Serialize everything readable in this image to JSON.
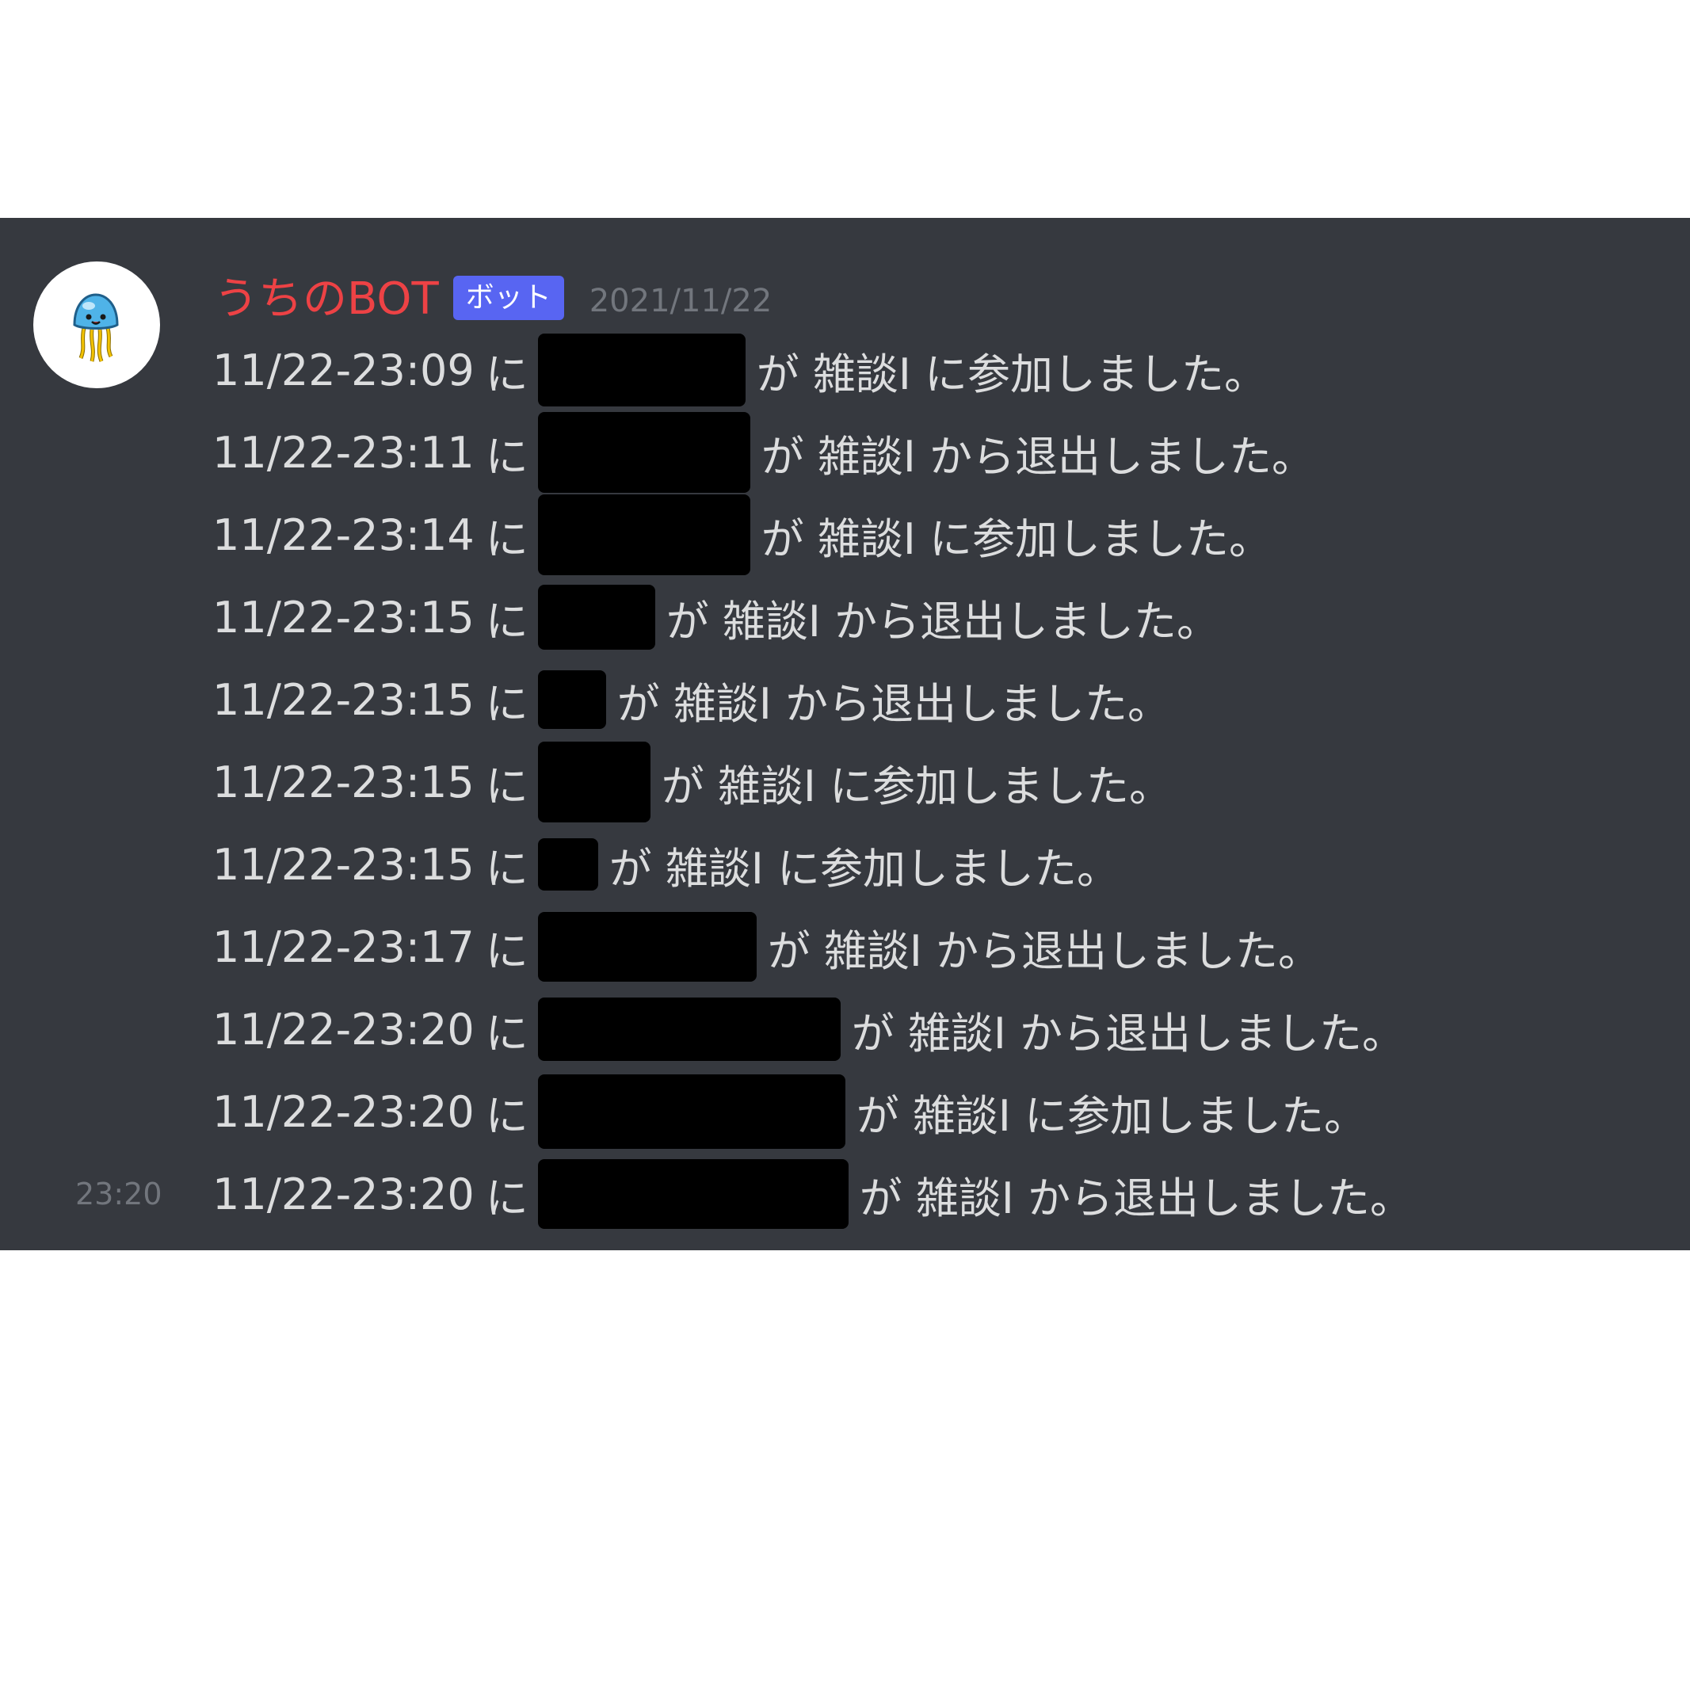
{
  "message": {
    "author": "うちのBOT",
    "bot_tag": "ボット",
    "date": "2021/11/22",
    "hover_time": "23:20",
    "avatar_icon": "jellyfish-icon",
    "colors": {
      "author": "#ed4245",
      "bot_tag": "#5865f2",
      "background": "#36393f",
      "text": "#dcddde",
      "muted": "#72767d"
    },
    "lines": [
      {
        "timestamp": "11/22-23:09",
        "particle": "に",
        "text": "が 雑談Ⅰ に参加しました。"
      },
      {
        "timestamp": "11/22-23:11",
        "particle": "に",
        "text": "が 雑談Ⅰ から退出しました。"
      },
      {
        "timestamp": "11/22-23:14",
        "particle": "に",
        "text": "が 雑談Ⅰ に参加しました。"
      },
      {
        "timestamp": "11/22-23:15",
        "particle": "に",
        "text": "が 雑談Ⅰ から退出しました。"
      },
      {
        "timestamp": "11/22-23:15",
        "particle": "に",
        "text": "が 雑談Ⅰ から退出しました。"
      },
      {
        "timestamp": "11/22-23:15",
        "particle": "に",
        "text": "が 雑談Ⅰ に参加しました。"
      },
      {
        "timestamp": "11/22-23:15",
        "particle": "に",
        "text": "が 雑談Ⅰ に参加しました。"
      },
      {
        "timestamp": "11/22-23:17",
        "particle": "に",
        "text": "が 雑談Ⅰ から退出しました。"
      },
      {
        "timestamp": "11/22-23:20",
        "particle": "に",
        "text": "が 雑談Ⅰ から退出しました。"
      },
      {
        "timestamp": "11/22-23:20",
        "particle": "に",
        "text": "が 雑談Ⅰ に参加しました。"
      },
      {
        "timestamp": "11/22-23:20",
        "particle": "に",
        "text": "が 雑談Ⅰ から退出しました。"
      }
    ]
  }
}
